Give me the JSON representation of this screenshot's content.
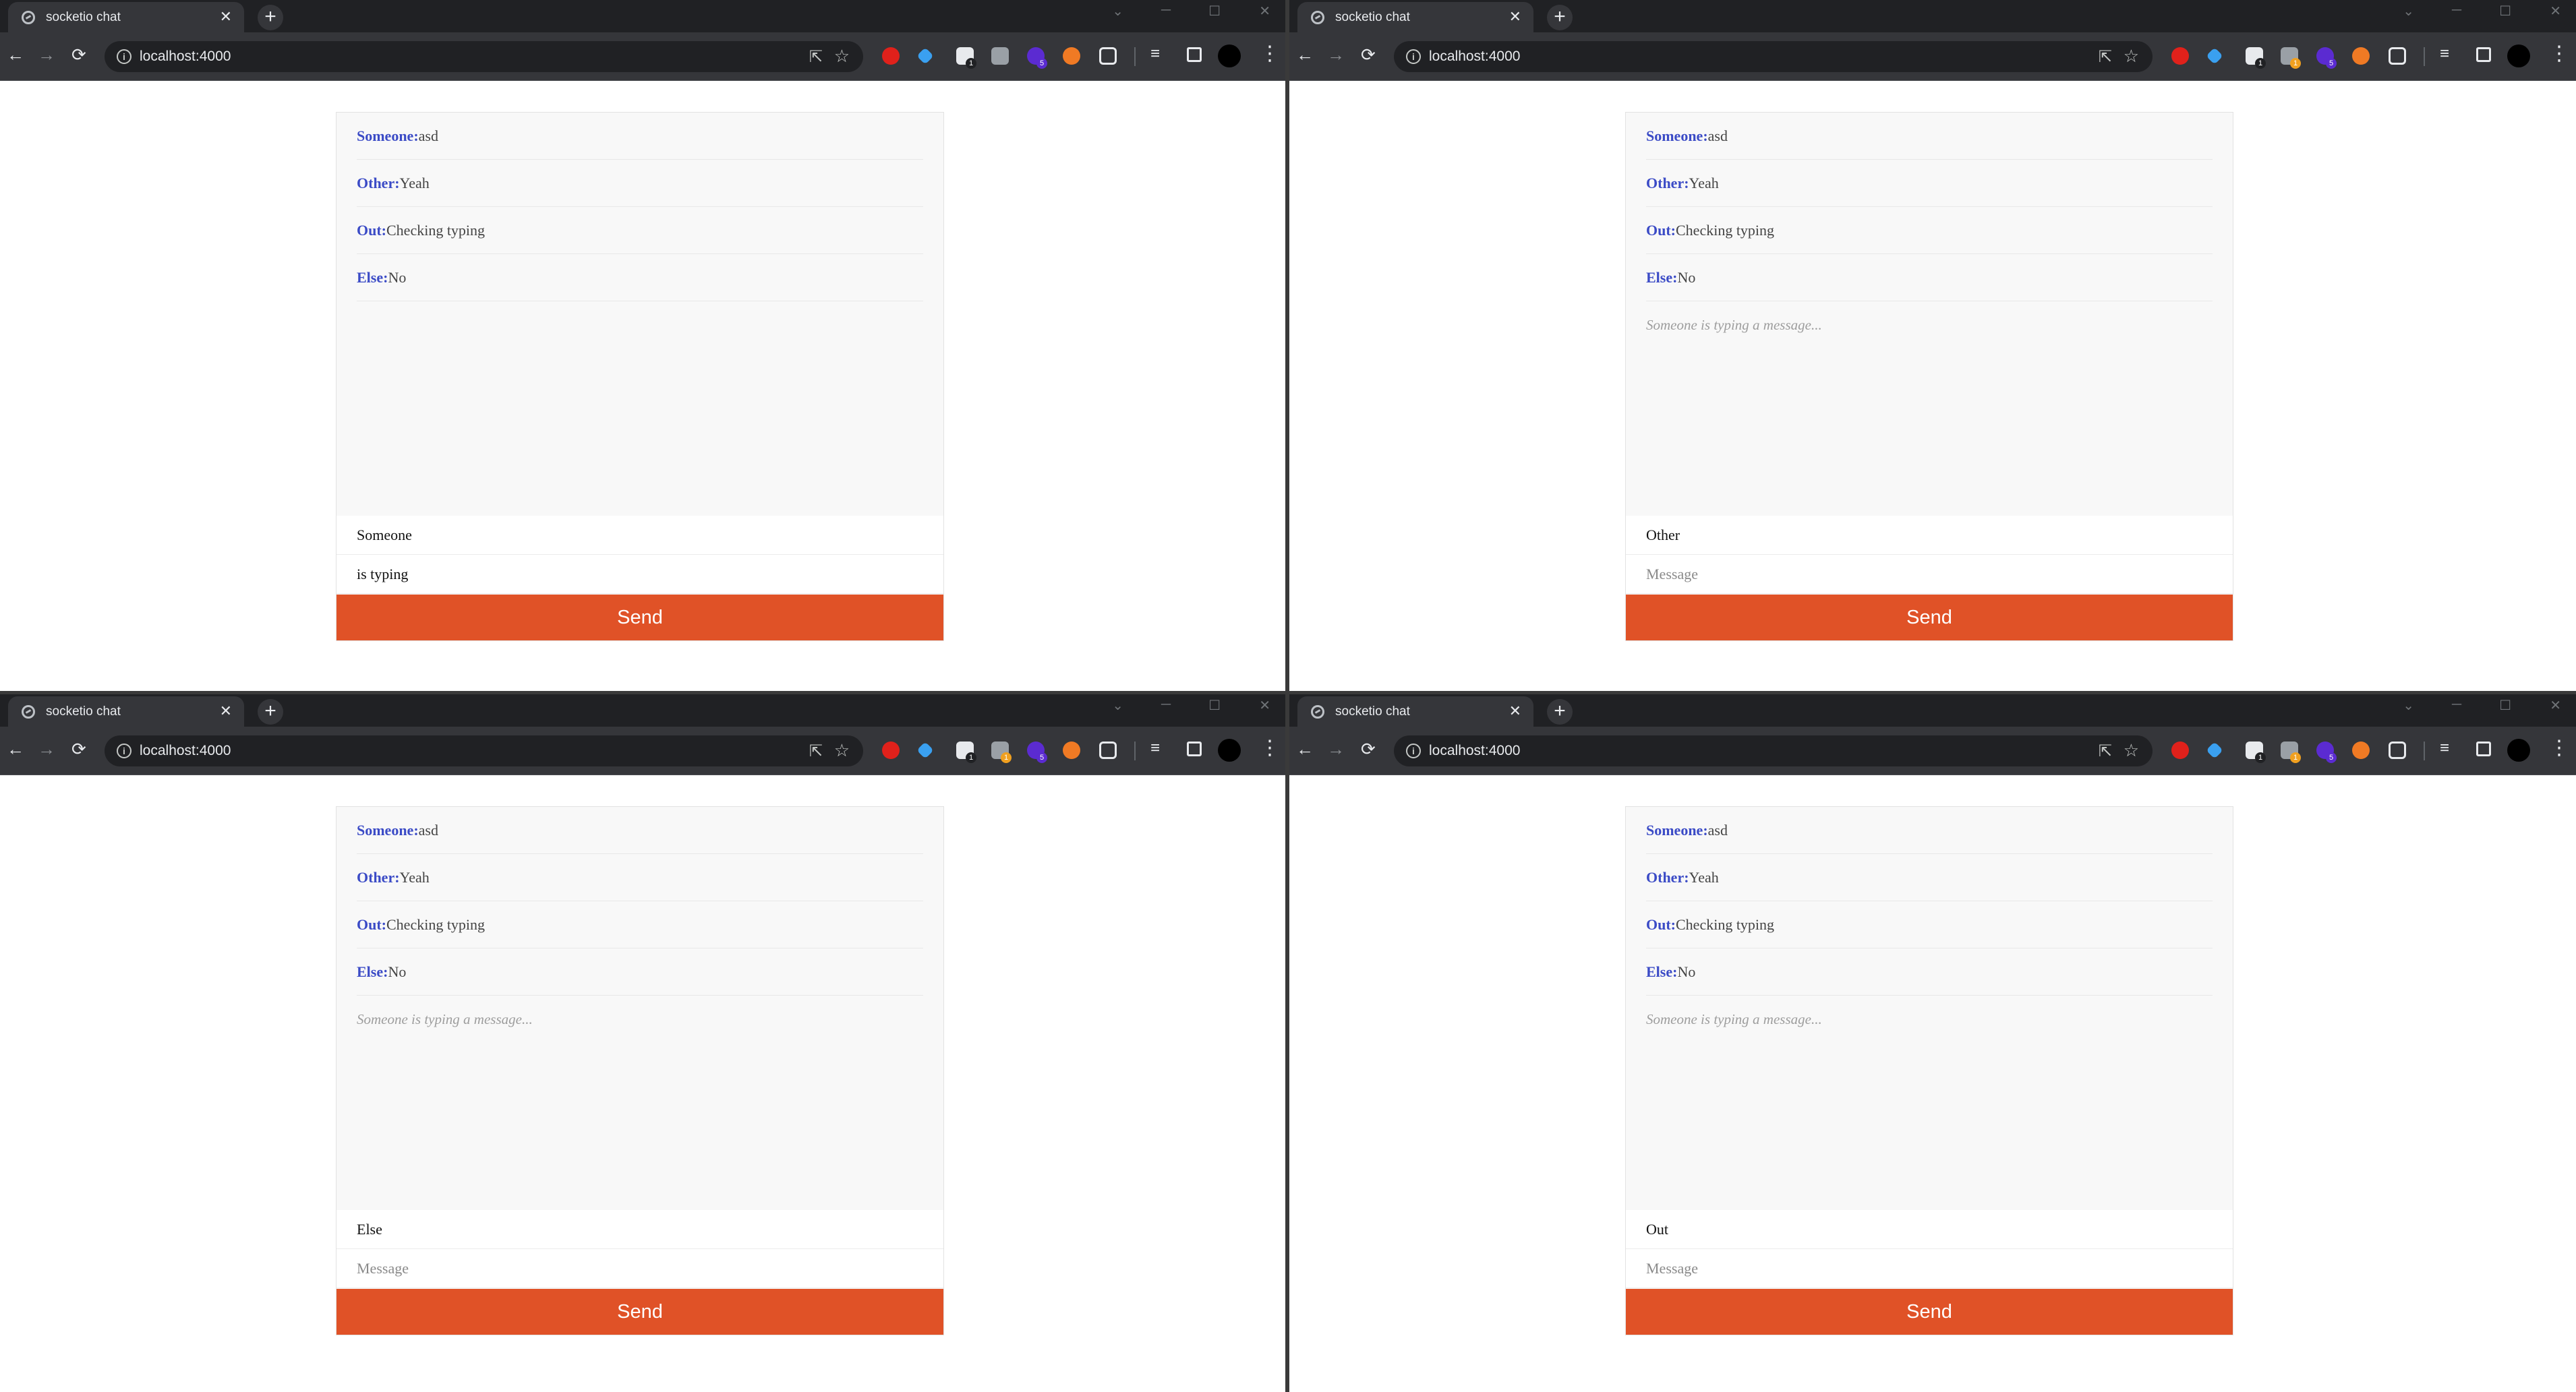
{
  "browser": {
    "tab_title": "socketio chat",
    "tab_close": "✕",
    "new_tab": "+",
    "url": "localhost:4000",
    "nav": {
      "back": "←",
      "forward": "→",
      "reload": "⟳"
    },
    "window_controls": {
      "dropdown": "⌄",
      "minimize": "─",
      "maximize": "☐",
      "close": "✕"
    },
    "extension_badges": {
      "ext3": "1",
      "ext4": "1",
      "ext5": "5"
    },
    "menu": "⋮",
    "icons": [
      "info-icon",
      "share-icon",
      "star-icon",
      "extensions-icon",
      "reading-list-icon",
      "side-panel-icon",
      "avatar",
      "menu-icon"
    ],
    "colors": {
      "frame": "#202124",
      "toolbar": "#35363a",
      "accent_send": "#e05227",
      "username": "#3b4bc6"
    }
  },
  "chat": {
    "messages": [
      {
        "user": "Someone:",
        "text": "asd"
      },
      {
        "user": "Other:",
        "text": "Yeah"
      },
      {
        "user": "Out:",
        "text": "Checking typing"
      },
      {
        "user": "Else:",
        "text": "No"
      }
    ],
    "typing_indicator": "Someone is typing a message...",
    "send_label": "Send",
    "message_placeholder": "Message"
  },
  "windows": [
    {
      "username": "Someone",
      "message_value": "is typing"
    },
    {
      "username": "Other",
      "message_value": ""
    },
    {
      "username": "Else",
      "message_value": ""
    },
    {
      "username": "Out",
      "message_value": ""
    }
  ]
}
